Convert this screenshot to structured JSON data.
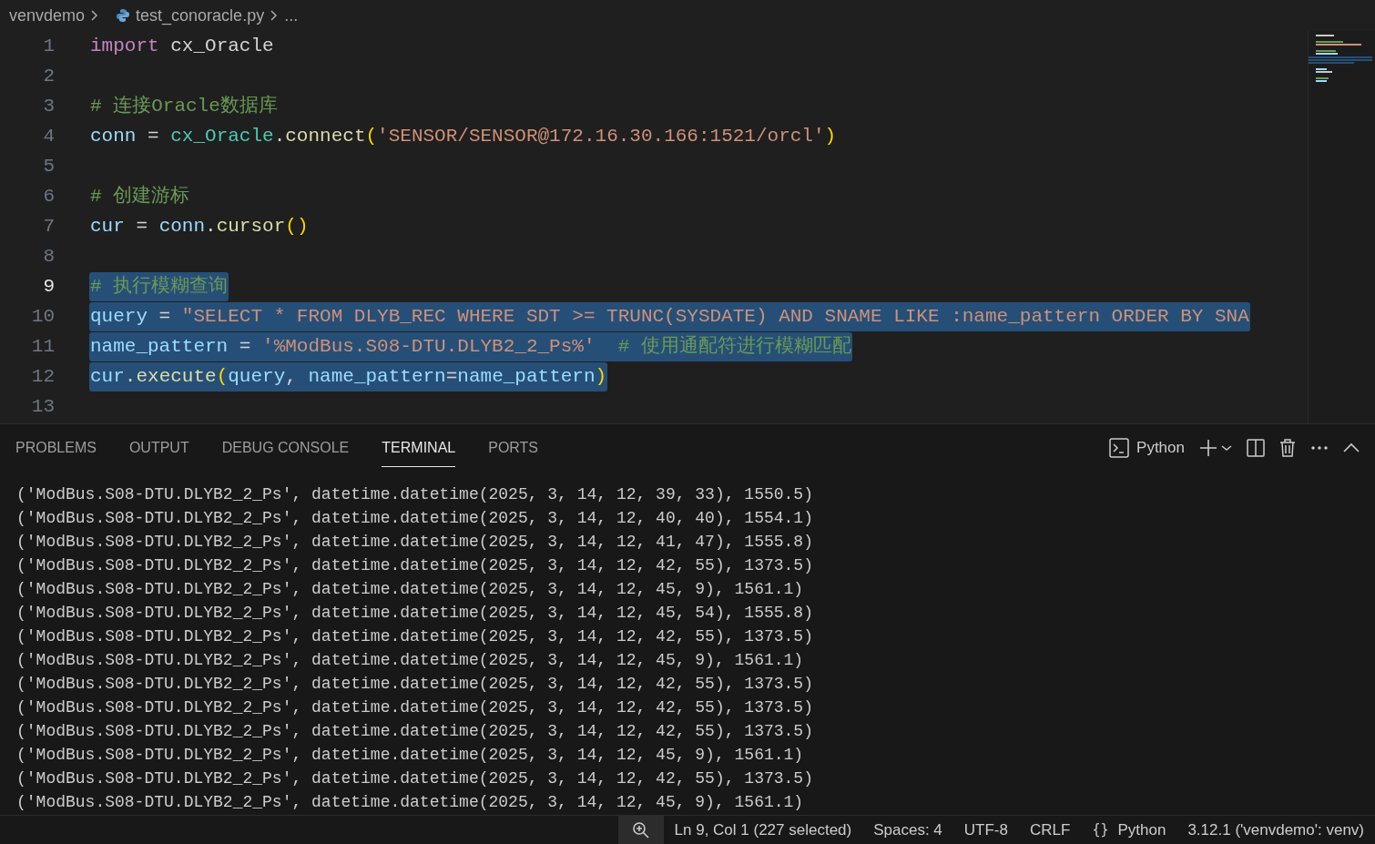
{
  "breadcrumb": {
    "folder": "venvdemo",
    "file": "test_conoracle.py",
    "more": "..."
  },
  "editor": {
    "lines": [
      {
        "number": "1",
        "selected": false,
        "current": false,
        "tokens": [
          {
            "kind": "keyword",
            "text": "import "
          },
          {
            "kind": "plain",
            "text": "cx_Oracle"
          }
        ]
      },
      {
        "number": "2",
        "selected": false,
        "current": false
      },
      {
        "number": "3",
        "selected": false,
        "current": false,
        "tokens": [
          {
            "kind": "comment",
            "text": "# 连接Oracle数据库"
          }
        ]
      },
      {
        "number": "4",
        "selected": false,
        "current": false,
        "tokens": [
          {
            "kind": "variable",
            "text": "conn"
          },
          {
            "kind": "plain",
            "text": " = "
          },
          {
            "kind": "class",
            "text": "cx_Oracle"
          },
          {
            "kind": "plain",
            "text": "."
          },
          {
            "kind": "function",
            "text": "connect"
          },
          {
            "kind": "bracket",
            "text": "("
          },
          {
            "kind": "string",
            "text": "'SENSOR/SENSOR@172.16.30.166:1521/orcl'"
          },
          {
            "kind": "bracket",
            "text": ")"
          }
        ]
      },
      {
        "number": "5",
        "selected": false,
        "current": false
      },
      {
        "number": "6",
        "selected": false,
        "current": false,
        "tokens": [
          {
            "kind": "comment",
            "text": "# 创建游标"
          }
        ]
      },
      {
        "number": "7",
        "selected": false,
        "current": false,
        "tokens": [
          {
            "kind": "variable",
            "text": "cur"
          },
          {
            "kind": "plain",
            "text": " = "
          },
          {
            "kind": "variable",
            "text": "conn"
          },
          {
            "kind": "plain",
            "text": "."
          },
          {
            "kind": "function",
            "text": "cursor"
          },
          {
            "kind": "bracket",
            "text": "()"
          }
        ]
      },
      {
        "number": "8",
        "selected": false,
        "current": false
      },
      {
        "number": "9",
        "selected": true,
        "current": true,
        "tokens": [
          {
            "kind": "comment",
            "text": "# 执行模糊查询"
          }
        ]
      },
      {
        "number": "10",
        "selected": true,
        "current": false,
        "tokens": [
          {
            "kind": "variable",
            "text": "query"
          },
          {
            "kind": "plain",
            "text": " = "
          },
          {
            "kind": "string",
            "text": "\"SELECT * FROM DLYB_REC WHERE SDT >= TRUNC(SYSDATE) AND SNAME LIKE :name_pattern ORDER BY SNA"
          }
        ]
      },
      {
        "number": "11",
        "selected": true,
        "current": false,
        "tokens": [
          {
            "kind": "variable",
            "text": "name_pattern"
          },
          {
            "kind": "plain",
            "text": " = "
          },
          {
            "kind": "string",
            "text": "'%ModBus.S08-DTU.DLYB2_2_Ps%'  "
          },
          {
            "kind": "comment",
            "text": "# 使用通配符进行模糊匹配"
          }
        ]
      },
      {
        "number": "12",
        "selected": true,
        "current": false,
        "tokens": [
          {
            "kind": "variable",
            "text": "cur"
          },
          {
            "kind": "plain",
            "text": "."
          },
          {
            "kind": "function",
            "text": "execute"
          },
          {
            "kind": "bracket",
            "text": "("
          },
          {
            "kind": "variable",
            "text": "query"
          },
          {
            "kind": "plain",
            "text": ", "
          },
          {
            "kind": "variable",
            "text": "name_pattern"
          },
          {
            "kind": "plain",
            "text": "="
          },
          {
            "kind": "variable",
            "text": "name_pattern"
          },
          {
            "kind": "bracket",
            "text": ")"
          }
        ]
      },
      {
        "number": "13",
        "selected": false,
        "current": false
      }
    ]
  },
  "panel": {
    "tabs": [
      {
        "label": "PROBLEMS",
        "selected": false
      },
      {
        "label": "OUTPUT",
        "selected": false
      },
      {
        "label": "DEBUG CONSOLE",
        "selected": false
      },
      {
        "label": "TERMINAL",
        "selected": true
      },
      {
        "label": "PORTS",
        "selected": false
      }
    ],
    "terminal_name": "Python",
    "terminal_lines": [
      "('ModBus.S08-DTU.DLYB2_2_Ps', datetime.datetime(2025, 3, 14, 12, 39, 33), 1550.5)",
      "('ModBus.S08-DTU.DLYB2_2_Ps', datetime.datetime(2025, 3, 14, 12, 40, 40), 1554.1)",
      "('ModBus.S08-DTU.DLYB2_2_Ps', datetime.datetime(2025, 3, 14, 12, 41, 47), 1555.8)",
      "('ModBus.S08-DTU.DLYB2_2_Ps', datetime.datetime(2025, 3, 14, 12, 42, 55), 1373.5)",
      "('ModBus.S08-DTU.DLYB2_2_Ps', datetime.datetime(2025, 3, 14, 12, 45, 9), 1561.1)",
      "('ModBus.S08-DTU.DLYB2_2_Ps', datetime.datetime(2025, 3, 14, 12, 45, 54), 1555.8)",
      "('ModBus.S08-DTU.DLYB2_2_Ps', datetime.datetime(2025, 3, 14, 12, 42, 55), 1373.5)",
      "('ModBus.S08-DTU.DLYB2_2_Ps', datetime.datetime(2025, 3, 14, 12, 45, 9), 1561.1)",
      "('ModBus.S08-DTU.DLYB2_2_Ps', datetime.datetime(2025, 3, 14, 12, 42, 55), 1373.5)",
      "('ModBus.S08-DTU.DLYB2_2_Ps', datetime.datetime(2025, 3, 14, 12, 42, 55), 1373.5)",
      "('ModBus.S08-DTU.DLYB2_2_Ps', datetime.datetime(2025, 3, 14, 12, 42, 55), 1373.5)",
      "('ModBus.S08-DTU.DLYB2_2_Ps', datetime.datetime(2025, 3, 14, 12, 45, 9), 1561.1)",
      "('ModBus.S08-DTU.DLYB2_2_Ps', datetime.datetime(2025, 3, 14, 12, 42, 55), 1373.5)",
      "('ModBus.S08-DTU.DLYB2_2_Ps', datetime.datetime(2025, 3, 14, 12, 45, 9), 1561.1)"
    ]
  },
  "status_bar": {
    "items": [
      {
        "kind": "cursor",
        "text": "Ln 9, Col 1 (227 selected)"
      },
      {
        "kind": "plain",
        "text": "Spaces: 4"
      },
      {
        "kind": "plain",
        "text": "UTF-8"
      },
      {
        "kind": "plain",
        "text": "CRLF"
      },
      {
        "kind": "language",
        "icon_text": "{}",
        "text": "Python"
      },
      {
        "kind": "plain",
        "text": "3.12.1 ('venvdemo': venv)"
      }
    ]
  }
}
